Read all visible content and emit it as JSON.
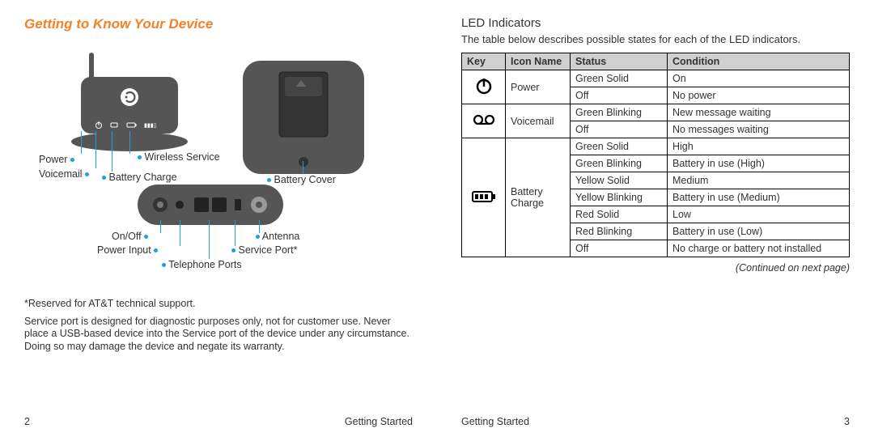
{
  "left": {
    "title": "Getting to Know Your Device",
    "labels": {
      "power": "Power",
      "voicemail": "Voicemail",
      "wireless_service": "Wireless Service",
      "battery_charge": "Battery Charge",
      "battery_cover": "Battery Cover",
      "on_off": "On/Off",
      "power_input": "Power Input",
      "telephone_ports": "Telephone Ports",
      "antenna": "Antenna",
      "service_port": "Service Port*"
    },
    "note1": "*Reserved for AT&T technical support.",
    "note2": "Service port is designed for diagnostic purposes only, not for customer use. Never place a USB-based device into the Service port of the device under any circumstance. Doing so may damage the device and negate its warranty.",
    "page_num": "2",
    "footer": "Getting Started"
  },
  "right": {
    "section": "LED Indicators",
    "intro": "The table below describes possible states for each of the LED indicators.",
    "headers": {
      "key": "Key",
      "icon_name": "Icon Name",
      "status": "Status",
      "condition": "Condition"
    },
    "rows": {
      "power": {
        "name": "Power",
        "states": [
          {
            "status": "Green Solid",
            "condition": "On"
          },
          {
            "status": "Off",
            "condition": "No power"
          }
        ]
      },
      "voicemail": {
        "name": "Voicemail",
        "states": [
          {
            "status": "Green Blinking",
            "condition": "New message waiting"
          },
          {
            "status": "Off",
            "condition": "No messages waiting"
          }
        ]
      },
      "battery": {
        "name": "Battery Charge",
        "states": [
          {
            "status": "Green Solid",
            "condition": "High"
          },
          {
            "status": "Green Blinking",
            "condition": "Battery in use (High)"
          },
          {
            "status": "Yellow Solid",
            "condition": "Medium"
          },
          {
            "status": "Yellow Blinking",
            "condition": "Battery in use (Medium)"
          },
          {
            "status": "Red Solid",
            "condition": "Low"
          },
          {
            "status": "Red Blinking",
            "condition": "Battery in use (Low)"
          },
          {
            "status": "Off",
            "condition": "No charge or battery not installed"
          }
        ]
      }
    },
    "continued": "(Continued on next page)",
    "page_num": "3",
    "footer": "Getting Started"
  }
}
